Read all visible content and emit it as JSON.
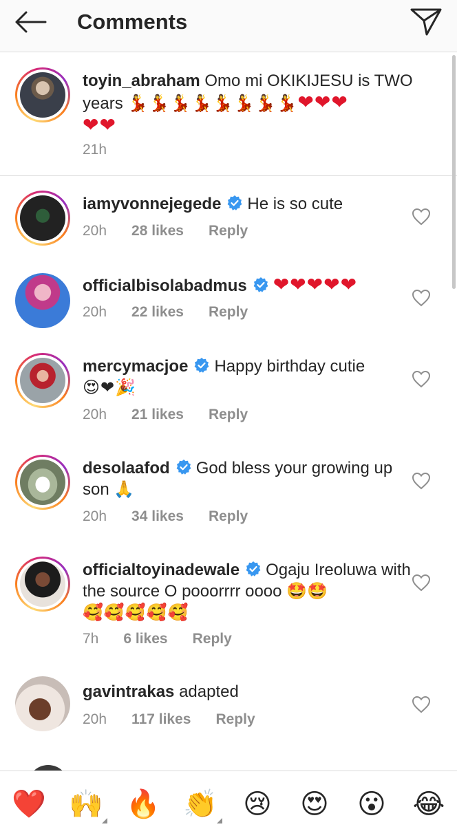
{
  "header": {
    "title": "Comments"
  },
  "caption": {
    "username": "toyin_abraham",
    "text": " Omo mi OKIKIJESU is TWO years ",
    "dancers": "💃💃💃💃💃💃💃💃",
    "hearts_inline": "❤❤❤",
    "hearts_line2": "❤❤",
    "time": "21h"
  },
  "comments": [
    {
      "username": "iamyvonnejegede",
      "verified": true,
      "text": "He is so cute",
      "time": "20h",
      "likes": "28 likes",
      "reply": "Reply"
    },
    {
      "username": "officialbisolabadmus",
      "verified": true,
      "text": "❤❤❤❤❤",
      "time": "20h",
      "likes": "22 likes",
      "reply": "Reply"
    },
    {
      "username": "mercymacjoe",
      "verified": true,
      "text": "Happy birthday cutie",
      "text2": "😍❤🎉",
      "time": "20h",
      "likes": "21 likes",
      "reply": "Reply"
    },
    {
      "username": "desolaafod",
      "verified": true,
      "text": "God bless your growing up son 🙏",
      "time": "20h",
      "likes": "34 likes",
      "reply": "Reply"
    },
    {
      "username": "officialtoyinadewale",
      "verified": true,
      "text": "Ogaju Ireoluwa with the source O pooorrrr oooo 🤩🤩",
      "text2": "🥰🥰🥰🥰🥰",
      "time": "7h",
      "likes": "6 likes",
      "reply": "Reply"
    },
    {
      "username": "gavintrakas",
      "verified": false,
      "text": "adapted",
      "time": "20h",
      "likes": "117 likes",
      "reply": "Reply"
    }
  ],
  "quick_emojis": [
    "❤️",
    "🙌",
    "🔥",
    "👏",
    "😢",
    "😍",
    "😮",
    "😂"
  ],
  "colors": {
    "verified": "#3897f0",
    "heart_red": "#e0162b",
    "muted": "#8e8e8e",
    "text": "#262626"
  }
}
